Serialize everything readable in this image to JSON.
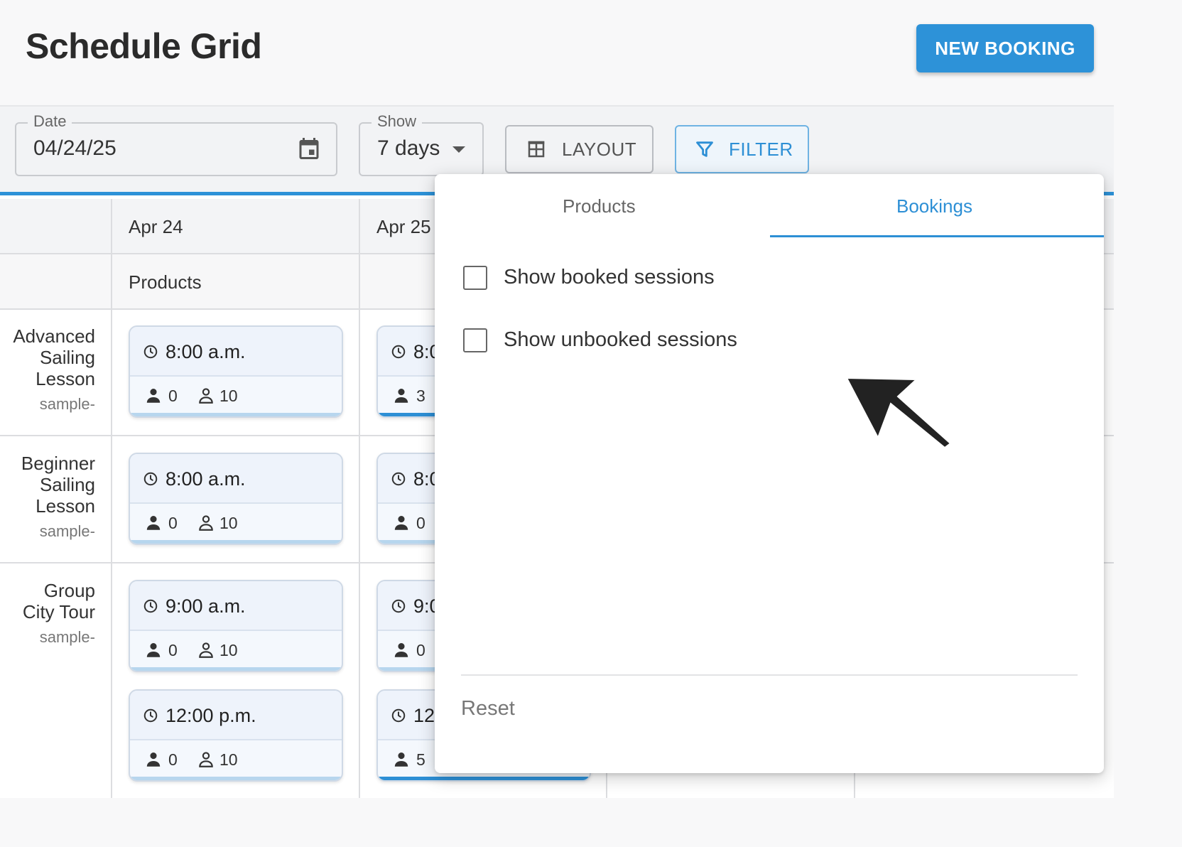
{
  "header": {
    "title": "Schedule Grid",
    "new_booking_label": "NEW BOOKING"
  },
  "toolbar": {
    "date": {
      "legend": "Date",
      "value": "04/24/25"
    },
    "show": {
      "legend": "Show",
      "value": "7 days"
    },
    "layout_label": "LAYOUT",
    "filter_label": "FILTER"
  },
  "grid": {
    "columns": [
      {
        "date": "Apr 24",
        "sub": "Products"
      },
      {
        "date": "Apr 25",
        "sub": ""
      }
    ],
    "rows": [
      {
        "lines": [
          "Advanced",
          "Sailing",
          "Lesson"
        ],
        "sample": "sample-"
      },
      {
        "lines": [
          "Beginner",
          "Sailing",
          "Lesson"
        ],
        "sample": "sample-"
      },
      {
        "lines": [
          "Group",
          "City Tour"
        ],
        "sample": "sample-"
      }
    ],
    "cards_col1": [
      {
        "time": "8:00 a.m.",
        "booked": "0",
        "capacity": "10"
      },
      {
        "time": "8:00 a.m.",
        "booked": "0",
        "capacity": "10"
      },
      {
        "time": "9:00 a.m.",
        "booked": "0",
        "capacity": "10"
      },
      {
        "time": "12:00 p.m.",
        "booked": "0",
        "capacity": "10"
      }
    ],
    "cards_col2": [
      {
        "time": "8:0",
        "booked": "3"
      },
      {
        "time": "8:0",
        "booked": "0"
      },
      {
        "time": "9:0",
        "booked": "0"
      },
      {
        "time": "12:",
        "booked": "5"
      }
    ]
  },
  "filter_popup": {
    "tabs": [
      "Products",
      "Bookings"
    ],
    "active_tab": "Bookings",
    "options": [
      {
        "label": "Show booked sessions",
        "checked": false
      },
      {
        "label": "Show unbooked sessions",
        "checked": false
      }
    ],
    "reset_label": "Reset"
  },
  "colors": {
    "accent": "#2d92d8",
    "text": "#333333"
  },
  "icons": [
    "calendar-icon",
    "caret-down-icon",
    "table-icon",
    "filter-icon",
    "clock-icon",
    "person-icon",
    "person-outline-icon",
    "cursor-arrow-icon"
  ]
}
